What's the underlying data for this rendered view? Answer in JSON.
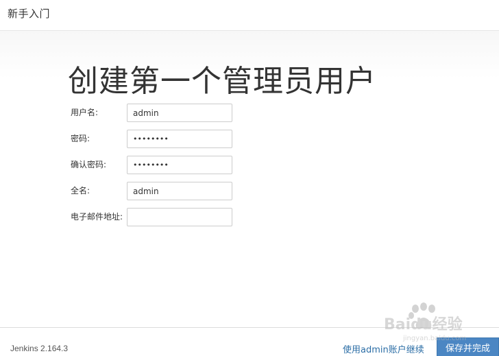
{
  "header": {
    "title": "新手入门"
  },
  "main": {
    "page_title": "创建第一个管理员用户",
    "form": {
      "fields": [
        {
          "label": "用户名:",
          "value": "admin",
          "type": "text"
        },
        {
          "label": "密码:",
          "value": "••••••••",
          "type": "password"
        },
        {
          "label": "确认密码:",
          "value": "••••••••",
          "type": "password"
        },
        {
          "label": "全名:",
          "value": "admin",
          "type": "text"
        },
        {
          "label": "电子邮件地址:",
          "value": "",
          "type": "text"
        }
      ]
    }
  },
  "footer": {
    "version": "Jenkins 2.164.3",
    "continue_link": "使用admin账户继续",
    "save_button": "保存并完成"
  },
  "watermark": {
    "text": "Baidu经验",
    "url": "jingyan.baidu.com"
  },
  "colors": {
    "primary_button": "#4b86c3",
    "link": "#2c6ea6",
    "text": "#333333"
  }
}
